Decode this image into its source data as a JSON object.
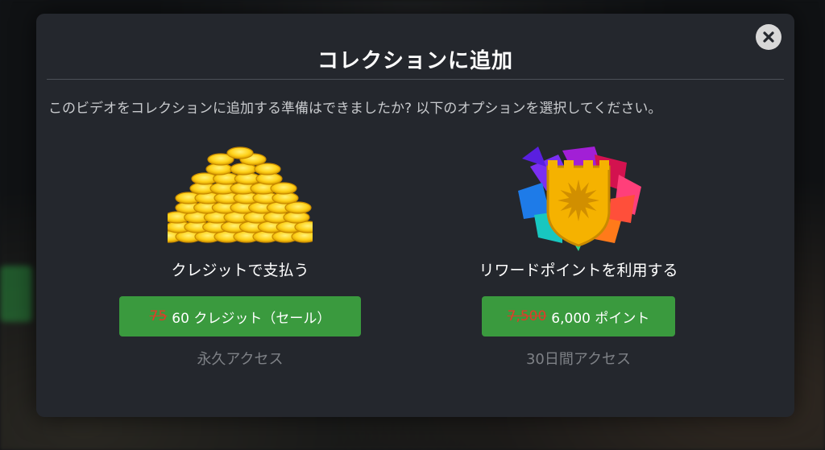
{
  "modal": {
    "title": "コレクションに追加",
    "description": "このビデオをコレクションに追加する準備はできましたか? 以下のオプションを選択してください。",
    "close_icon": "close-icon"
  },
  "options": [
    {
      "icon": "gold-coins-icon",
      "label": "クレジットで支払う",
      "old_price": "75",
      "new_price": "60 クレジット（セール）",
      "access": "永久アクセス"
    },
    {
      "icon": "rewards-shield-icon",
      "label": "リワードポイントを利用する",
      "old_price": "7,500",
      "new_price": "6,000 ポイント",
      "access": "30日間アクセス"
    }
  ],
  "colors": {
    "modal_bg": "#24272d",
    "button_green": "#3a9a3e",
    "strike_red": "#e23a2a"
  }
}
